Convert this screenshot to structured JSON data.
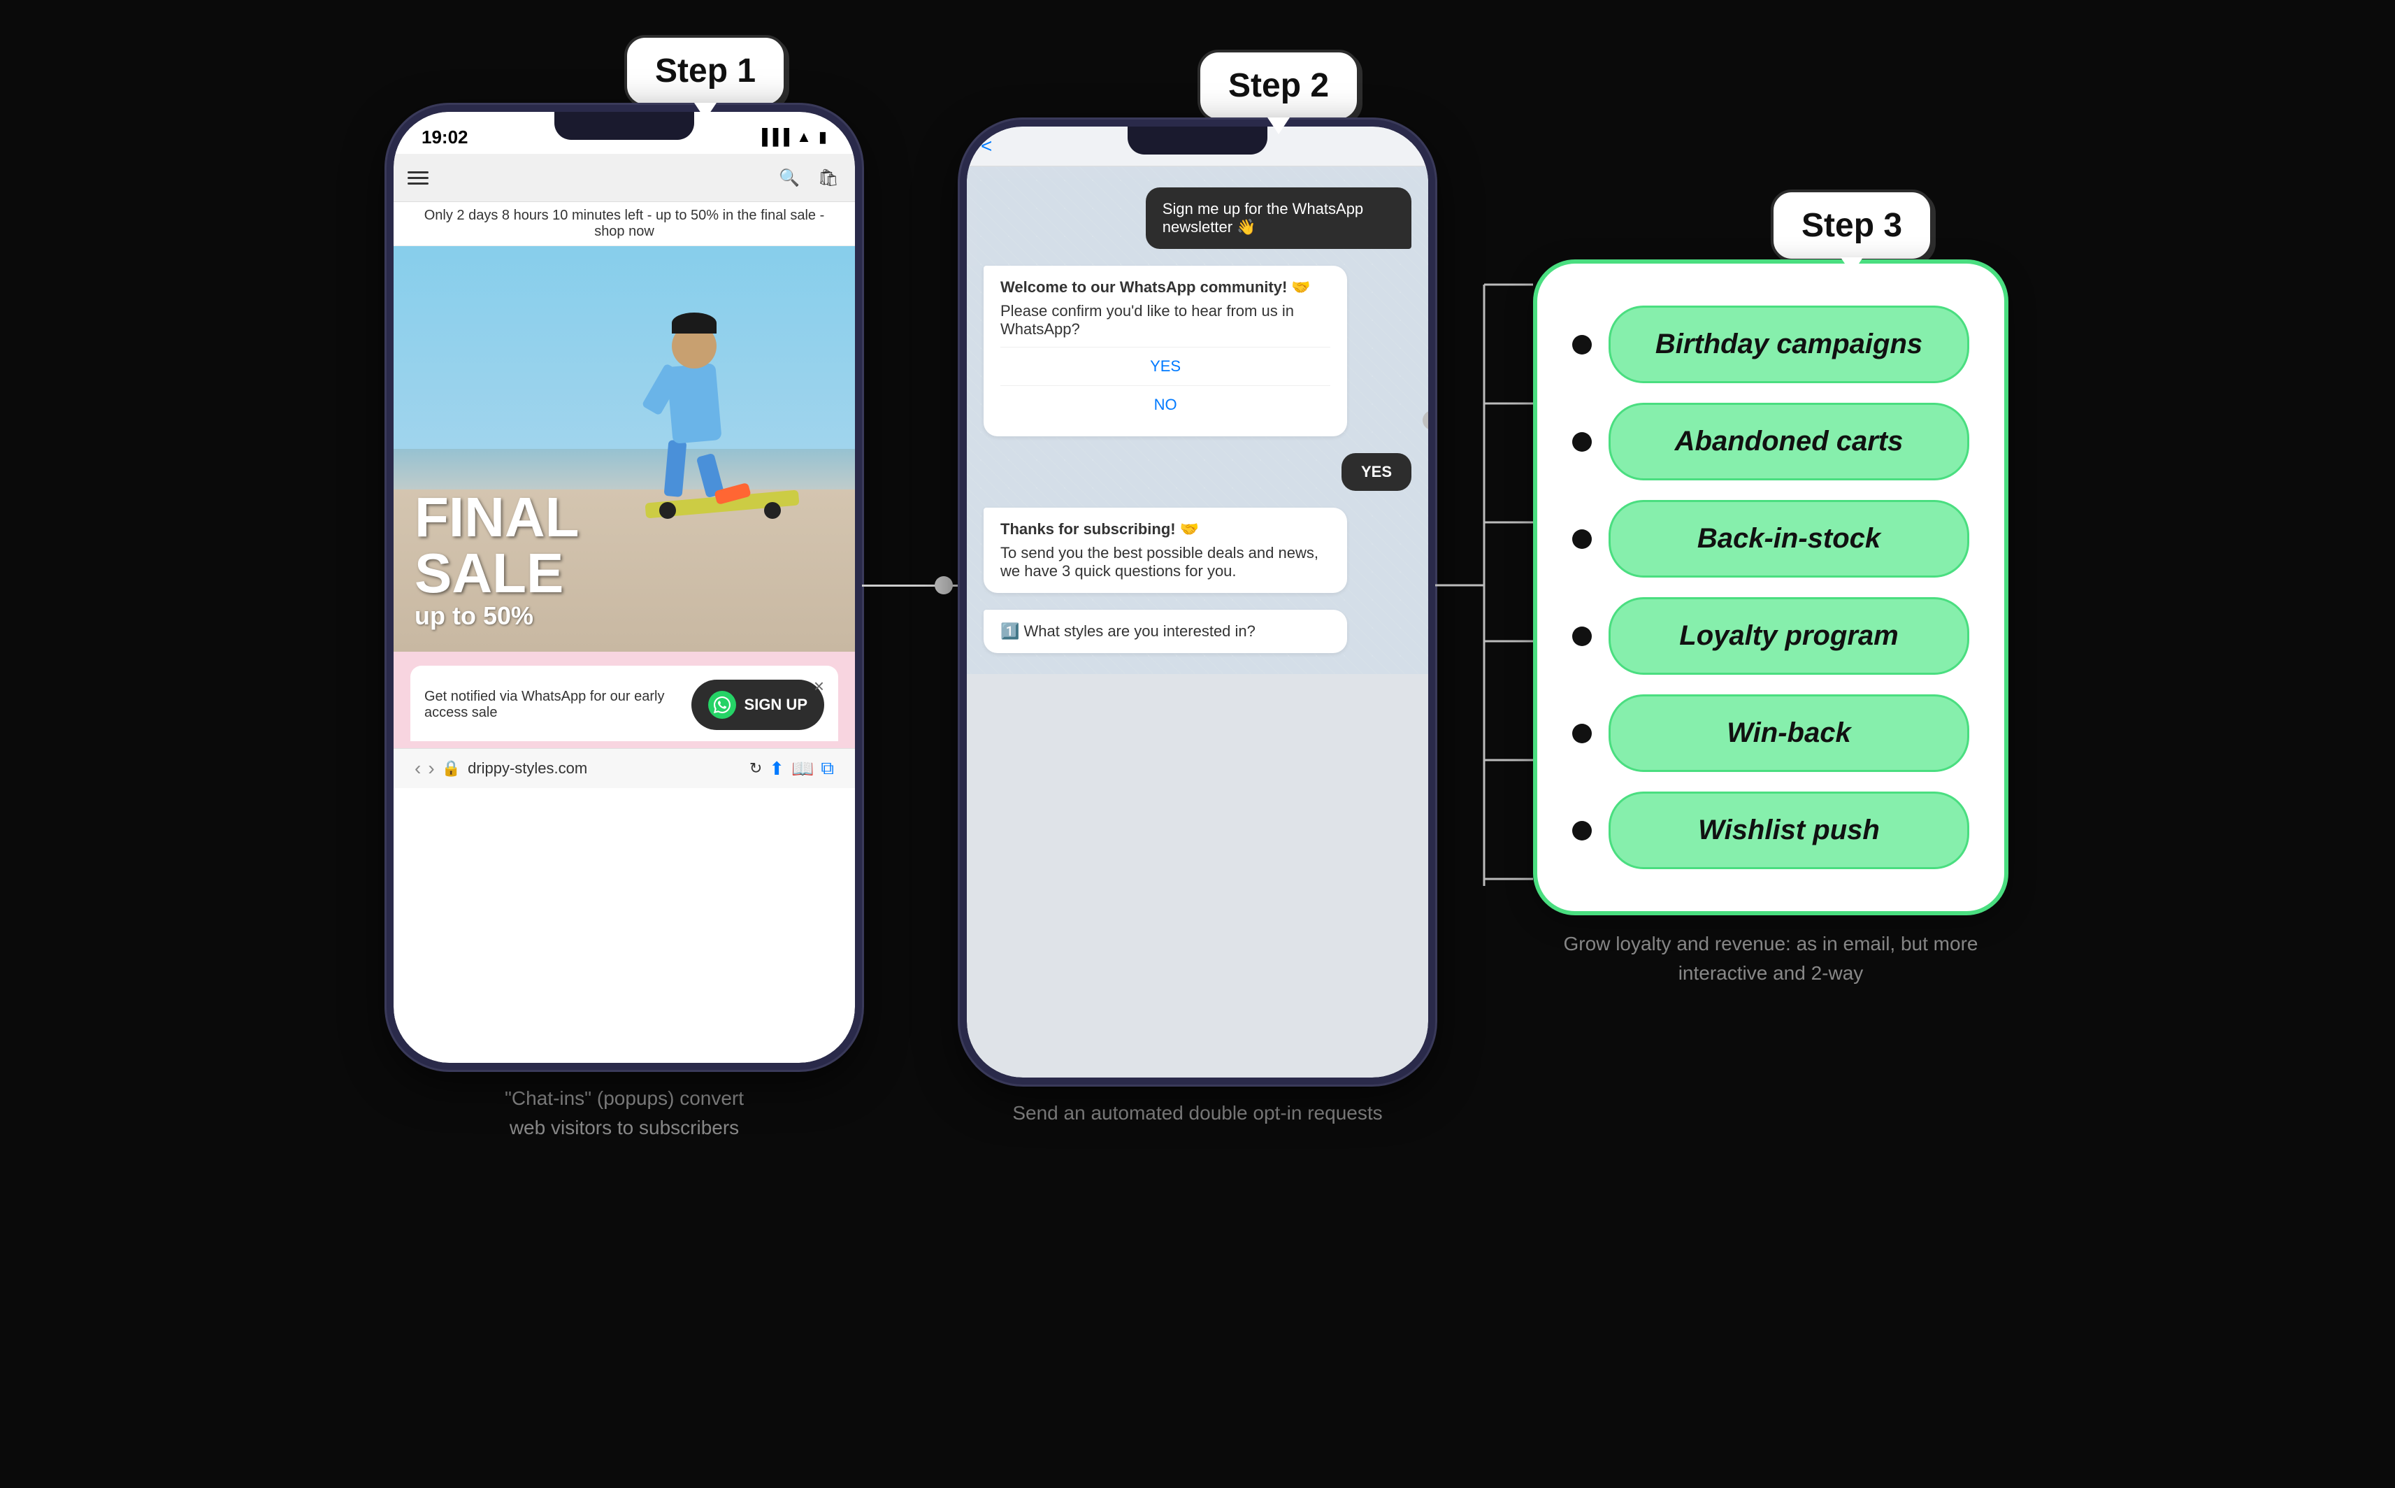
{
  "steps": {
    "step1": {
      "label": "Step 1"
    },
    "step2": {
      "label": "Step 2"
    },
    "step3": {
      "label": "Step 3"
    }
  },
  "phone1": {
    "time": "19:02",
    "banner": "Only 2 days 8 hours 10 minutes left - up to 50% in the final sale - shop now",
    "sale_line1": "FINAL",
    "sale_line2": "SALE",
    "sale_sub": "up to 50%",
    "popup_text": "Get notified via WhatsApp for our early access sale",
    "popup_btn": "SIGN UP",
    "url": "drippy-styles.com"
  },
  "phone2": {
    "back": "<",
    "msg_out": "Sign me up for the WhatsApp newsletter 👋",
    "msg_in_title": "Welcome to our WhatsApp community! 🤝",
    "msg_in_body": "Please confirm you'd like to hear from us in WhatsApp?",
    "yes_option": "YES",
    "no_option": "NO",
    "yes_reply": "YES",
    "msg2_title": "Thanks for subscribing! 🤝",
    "msg2_body": "To send you the best possible deals and news, we have 3 quick questions for you.",
    "msg3": "1️⃣ What styles are you interested in?"
  },
  "step3_campaigns": [
    {
      "label": "Birthday campaigns"
    },
    {
      "label": "Abandoned carts"
    },
    {
      "label": "Back-in-stock"
    },
    {
      "label": "Loyalty program"
    },
    {
      "label": "Win-back"
    },
    {
      "label": "Wishlist push"
    }
  ],
  "captions": {
    "c1": "\"Chat-ins\" (popups) convert\nweb visitors to subscribers",
    "c2": "Send an automated\ndouble opt-in requests",
    "c3": "Grow loyalty and revenue: as in email,\nbut more interactive and 2-way"
  },
  "colors": {
    "green_border": "#4ade80",
    "green_pill": "#86efac",
    "dark": "#2d2d2d",
    "blue": "#007aff"
  }
}
